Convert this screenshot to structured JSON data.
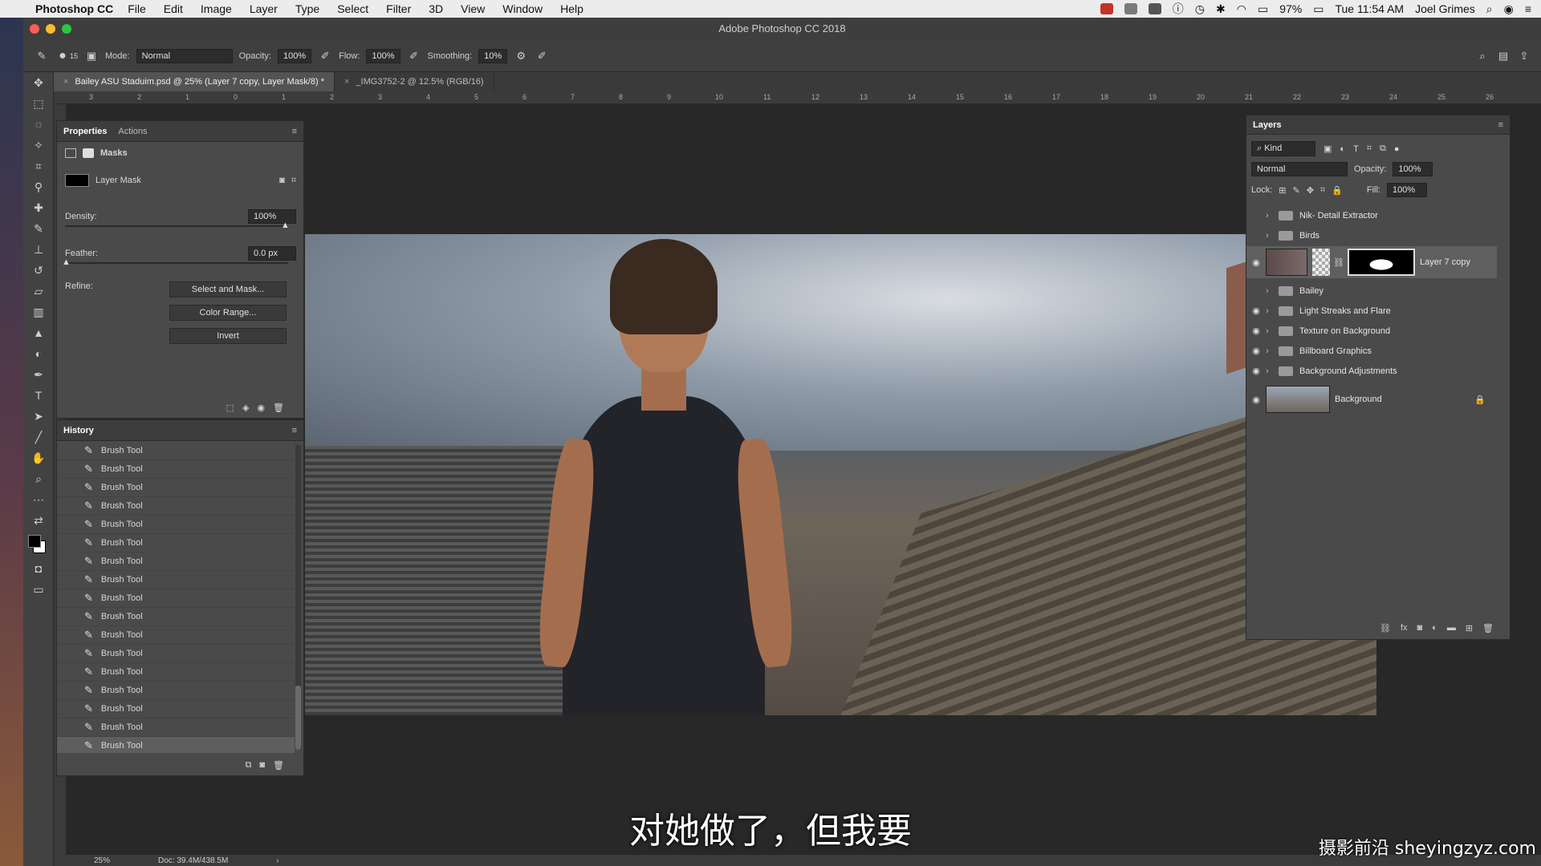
{
  "menubar": {
    "app": "Photoshop CC",
    "items": [
      "File",
      "Edit",
      "Image",
      "Layer",
      "Type",
      "Select",
      "Filter",
      "3D",
      "View",
      "Window",
      "Help"
    ],
    "battery": "97%",
    "clock": "Tue 11:54 AM",
    "user": "Joel Grimes"
  },
  "window": {
    "title": "Adobe Photoshop CC 2018"
  },
  "options": {
    "brush_size": "15",
    "mode_label": "Mode:",
    "mode_value": "Normal",
    "opacity_label": "Opacity:",
    "opacity_value": "100%",
    "flow_label": "Flow:",
    "flow_value": "100%",
    "smoothing_label": "Smoothing:",
    "smoothing_value": "10%"
  },
  "tabs": [
    {
      "label": "Bailey ASU Staduim.psd @ 25% (Layer 7 copy, Layer Mask/8) *"
    },
    {
      "label": "_IMG3752-2 @ 12.5% (RGB/16)"
    }
  ],
  "ruler_top": [
    "3",
    "2",
    "1",
    "0",
    "1",
    "2",
    "3",
    "4",
    "5",
    "6",
    "7",
    "8",
    "9",
    "10",
    "11",
    "12",
    "13",
    "14",
    "15",
    "16",
    "17",
    "18",
    "19",
    "20",
    "21",
    "22",
    "23",
    "24",
    "25",
    "26"
  ],
  "properties": {
    "tabs": [
      "Properties",
      "Actions"
    ],
    "section": "Masks",
    "mask_label": "Layer Mask",
    "density_label": "Density:",
    "density_value": "100%",
    "feather_label": "Feather:",
    "feather_value": "0.0 px",
    "refine_label": "Refine:",
    "buttons": [
      "Select and Mask...",
      "Color Range...",
      "Invert"
    ]
  },
  "history": {
    "title": "History",
    "items": [
      "Brush Tool",
      "Brush Tool",
      "Brush Tool",
      "Brush Tool",
      "Brush Tool",
      "Brush Tool",
      "Brush Tool",
      "Brush Tool",
      "Brush Tool",
      "Brush Tool",
      "Brush Tool",
      "Brush Tool",
      "Brush Tool",
      "Brush Tool",
      "Brush Tool",
      "Brush Tool",
      "Brush Tool"
    ]
  },
  "layers": {
    "title": "Layers",
    "filter": "Kind",
    "blend": "Normal",
    "opacity_label": "Opacity:",
    "opacity_value": "100%",
    "lock_label": "Lock:",
    "fill_label": "Fill:",
    "fill_value": "100%",
    "rows": [
      {
        "name": "Nik- Detail Extractor",
        "type": "group",
        "visible": false
      },
      {
        "name": "Birds",
        "type": "group",
        "visible": false
      },
      {
        "name": "Layer 7 copy",
        "type": "layer",
        "visible": true,
        "selected": true
      },
      {
        "name": "Bailey",
        "type": "group",
        "visible": false
      },
      {
        "name": "Light Streaks and Flare",
        "type": "group",
        "visible": true
      },
      {
        "name": "Texture on Background",
        "type": "group",
        "visible": true
      },
      {
        "name": "Billboard Graphics",
        "type": "group",
        "visible": true
      },
      {
        "name": "Background Adjustments",
        "type": "group",
        "visible": true
      },
      {
        "name": "Background",
        "type": "background",
        "visible": true
      }
    ]
  },
  "status": {
    "zoom": "25%",
    "doc": "Doc: 39.4M/438.5M"
  },
  "subtitle": "对她做了，但我要",
  "watermark": "摄影前沿 sheyingzyz.com",
  "colors": {
    "panel": "#4a4a4a",
    "canvas": "#282828",
    "menubar": "#ececec"
  }
}
